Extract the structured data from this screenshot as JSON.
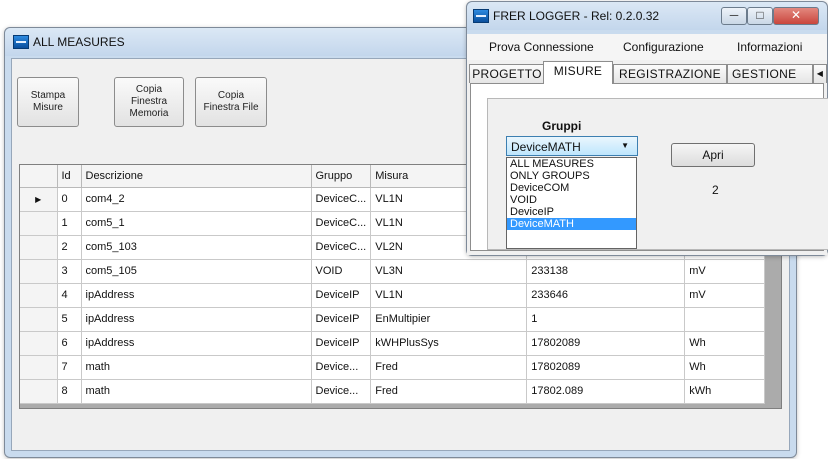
{
  "main_window": {
    "title": "ALL MEASURES",
    "toolbar": {
      "stampa_label": "Stampa\nMisure",
      "copia_memoria_label": "Copia\nFinestra\nMemoria",
      "copia_file_label": "Copia\nFinestra File"
    },
    "grid": {
      "columns": [
        "Id",
        "Descrizione",
        "Gruppo",
        "Misura",
        "",
        ""
      ],
      "rows": [
        {
          "id": "0",
          "descrizione": "com4_2",
          "gruppo": "DeviceC...",
          "misura": "VL1N",
          "valore": "",
          "unita": ""
        },
        {
          "id": "1",
          "descrizione": "com5_1",
          "gruppo": "DeviceC...",
          "misura": "VL1N",
          "valore": "",
          "unita": ""
        },
        {
          "id": "2",
          "descrizione": "com5_103",
          "gruppo": "DeviceC...",
          "misura": "VL2N",
          "valore": "",
          "unita": ""
        },
        {
          "id": "3",
          "descrizione": "com5_105",
          "gruppo": "VOID",
          "misura": "VL3N",
          "valore": "233138",
          "unita": "mV"
        },
        {
          "id": "4",
          "descrizione": "ipAddress",
          "gruppo": "DeviceIP",
          "misura": "VL1N",
          "valore": "233646",
          "unita": "mV"
        },
        {
          "id": "5",
          "descrizione": "ipAddress",
          "gruppo": "DeviceIP",
          "misura": "EnMultipier",
          "valore": "1",
          "unita": ""
        },
        {
          "id": "6",
          "descrizione": "ipAddress",
          "gruppo": "DeviceIP",
          "misura": "kWHPlusSys",
          "valore": "17802089",
          "unita": "Wh"
        },
        {
          "id": "7",
          "descrizione": "math",
          "gruppo": "Device...",
          "misura": "Fred",
          "valore": "17802089",
          "unita": "Wh"
        },
        {
          "id": "8",
          "descrizione": "math",
          "gruppo": "Device...",
          "misura": "Fred",
          "valore": "17802.089",
          "unita": "kWh"
        }
      ]
    }
  },
  "logger_window": {
    "title": "FRER LOGGER - Rel: 0.2.0.32",
    "menu": [
      "Prova Connessione",
      "Configurazione",
      "Informazioni"
    ],
    "tabs": [
      "PROGETTO",
      "MISURE",
      "REGISTRAZIONE",
      "GESTIONE"
    ],
    "active_tab": "MISURE",
    "gruppi_label": "Gruppi",
    "combo_value": "DeviceMATH",
    "apri_label": "Apri",
    "count_text": "2",
    "dropdown_options": [
      "ALL MEASURES",
      "ONLY GROUPS",
      "DeviceCOM",
      "VOID",
      "DeviceIP",
      "DeviceMATH"
    ],
    "selected_option": "DeviceMATH"
  },
  "colors": {
    "selection": "#3399ff",
    "titlebar": "#c9dbee",
    "close_button": "#c9463d"
  }
}
